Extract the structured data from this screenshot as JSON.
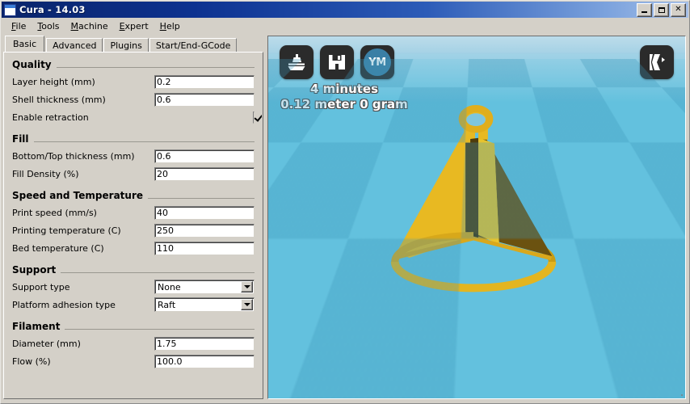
{
  "window": {
    "title": "Cura - 14.03",
    "icon": "window-icon",
    "controls": [
      {
        "name": "minimize",
        "glyph": "_"
      },
      {
        "name": "maximize",
        "glyph": "□"
      },
      {
        "name": "close",
        "glyph": "✕"
      }
    ]
  },
  "menubar": {
    "items": [
      "File",
      "Tools",
      "Machine",
      "Expert",
      "Help"
    ]
  },
  "tabs": [
    {
      "label": "Basic",
      "active": true
    },
    {
      "label": "Advanced",
      "active": false
    },
    {
      "label": "Plugins",
      "active": false
    },
    {
      "label": "Start/End-GCode",
      "active": false
    }
  ],
  "sections": [
    {
      "title": "Quality",
      "rows": [
        {
          "label": "Layer height (mm)",
          "type": "text",
          "value": "0.2"
        },
        {
          "label": "Shell thickness (mm)",
          "type": "text",
          "value": "0.6"
        },
        {
          "label": "Enable retraction",
          "type": "checkbox",
          "checked": true
        }
      ]
    },
    {
      "title": "Fill",
      "rows": [
        {
          "label": "Bottom/Top thickness (mm)",
          "type": "text",
          "value": "0.6"
        },
        {
          "label": "Fill Density (%)",
          "type": "text",
          "value": "20"
        }
      ]
    },
    {
      "title": "Speed and Temperature",
      "rows": [
        {
          "label": "Print speed (mm/s)",
          "type": "text",
          "value": "40"
        },
        {
          "label": "Printing temperature (C)",
          "type": "text",
          "value": "250"
        },
        {
          "label": "Bed temperature (C)",
          "type": "text",
          "value": "110"
        }
      ]
    },
    {
      "title": "Support",
      "rows": [
        {
          "label": "Support type",
          "type": "select",
          "value": "None"
        },
        {
          "label": "Platform adhesion type",
          "type": "select",
          "value": "Raft"
        }
      ]
    },
    {
      "title": "Filament",
      "rows": [
        {
          "label": "Diameter (mm)",
          "type": "text",
          "value": "1.75"
        },
        {
          "label": "Flow (%)",
          "type": "text",
          "value": "100.0"
        }
      ]
    }
  ],
  "viewport": {
    "toolbar": [
      {
        "name": "load-model-icon",
        "label": "Load model"
      },
      {
        "name": "save-toolpath-icon",
        "label": "Save toolpath"
      },
      {
        "name": "share-youmagine-icon",
        "label": "YM"
      }
    ],
    "view_mode_icon": "view-mode-icon",
    "status": {
      "time": "4 minutes",
      "material": "0.12 meter 0 gram"
    },
    "model": {
      "name": "cone-with-vanes",
      "color_lit": "#eec32a",
      "color_mid": "#e0a81f",
      "color_shadow": "#6b5210",
      "color_dark": "#4f3c0c"
    },
    "platform": {
      "tile_light": "#63c1de",
      "tile_dark": "#55aecb",
      "sky": "#bcdcea"
    }
  },
  "colors": {
    "title_bar_start": "#0a246a",
    "title_bar_end": "#a6c0e8",
    "window_face": "#d4d0c8",
    "accent": "#3b7fa5"
  }
}
